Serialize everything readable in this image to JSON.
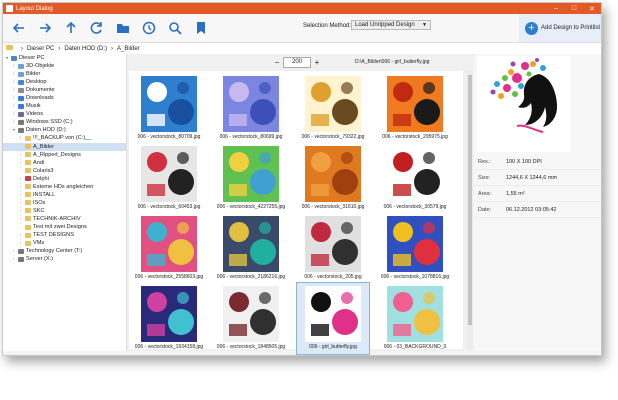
{
  "window": {
    "title": "Layout Dialog",
    "accent": "#e35a27"
  },
  "toolbar": {
    "icons": [
      "back-arrow-icon",
      "forward-arrow-icon",
      "up-arrow-icon",
      "refresh-icon",
      "folder-icon",
      "clock-icon",
      "zoom-icon",
      "bookmark-icon"
    ],
    "selection_label": "Selection Method:",
    "selection_value": "Load Unripped Design",
    "add_button": "Add Design to Printlist"
  },
  "breadcrumb": [
    "Dieser PC",
    "Daten HOD (D:)",
    "A_Bilder"
  ],
  "tree": [
    {
      "label": "Dieser PC",
      "indent": 0,
      "exp": "v",
      "color": "#4a86c8"
    },
    {
      "label": "3D-Objekte",
      "indent": 1,
      "exp": ">",
      "color": "#6aa0d8"
    },
    {
      "label": "Bilder",
      "indent": 1,
      "exp": ">",
      "color": "#6aa0d8"
    },
    {
      "label": "Desktop",
      "indent": 1,
      "exp": ">",
      "color": "#4a86c8"
    },
    {
      "label": "Dokumente",
      "indent": 1,
      "exp": ">",
      "color": "#8a8a8a"
    },
    {
      "label": "Downloads",
      "indent": 1,
      "exp": ">",
      "color": "#3a7bd5"
    },
    {
      "label": "Musik",
      "indent": 1,
      "exp": ">",
      "color": "#3a7bd5"
    },
    {
      "label": "Videos",
      "indent": 1,
      "exp": ">",
      "color": "#6a6a9a"
    },
    {
      "label": "Windows SSD (C:)",
      "indent": 1,
      "exp": ">",
      "color": "#777"
    },
    {
      "label": "Daten HOD (D:)",
      "indent": 1,
      "exp": "v",
      "color": "#777"
    },
    {
      "label": "!!!_BACKUP von (C:)__",
      "indent": 2,
      "exp": ">",
      "color": "#e8c25c"
    },
    {
      "label": "A_Bilder",
      "indent": 2,
      "exp": "",
      "color": "#e8c25c",
      "selected": true
    },
    {
      "label": "A_Ripped_Designs",
      "indent": 2,
      "exp": ">",
      "color": "#e8c25c"
    },
    {
      "label": "Andi",
      "indent": 2,
      "exp": ">",
      "color": "#e8c25c"
    },
    {
      "label": "Colaris3",
      "indent": 2,
      "exp": "",
      "color": "#e8c25c"
    },
    {
      "label": "Delphi",
      "indent": 2,
      "exp": ">",
      "color": "#d04040"
    },
    {
      "label": "Externe HDs angleichen",
      "indent": 2,
      "exp": ">",
      "color": "#e8c25c"
    },
    {
      "label": "INSTALL",
      "indent": 2,
      "exp": ">",
      "color": "#e8c25c"
    },
    {
      "label": "ISOs",
      "indent": 2,
      "exp": ">",
      "color": "#e8c25c"
    },
    {
      "label": "SKC",
      "indent": 2,
      "exp": ">",
      "color": "#e8c25c"
    },
    {
      "label": "TECHNIK-ARCHIV",
      "indent": 2,
      "exp": ">",
      "color": "#e8c25c"
    },
    {
      "label": "Test mit zwei Designs",
      "indent": 2,
      "exp": "",
      "color": "#e8c25c"
    },
    {
      "label": "TEST DESIGNS",
      "indent": 2,
      "exp": ">",
      "color": "#e8c25c"
    },
    {
      "label": "VMs",
      "indent": 2,
      "exp": ">",
      "color": "#e8c25c"
    },
    {
      "label": "Technology Center (T:)",
      "indent": 1,
      "exp": ">",
      "color": "#777"
    },
    {
      "label": "Server (X:)",
      "indent": 1,
      "exp": ">",
      "color": "#777"
    }
  ],
  "zoom": {
    "minus": "−",
    "value": "200",
    "plus": "+"
  },
  "current_path": "D:\\A_Bilder\\006 - girl_butterfly.jpg",
  "thumbnails": [
    {
      "caption": "006 - vectorstock_80709.jpg",
      "c1": "#2f7fd0",
      "c2": "#ffffff",
      "c3": "#1a4fa0"
    },
    {
      "caption": "006 - vectorstock_80699.jpg",
      "c1": "#7a86e0",
      "c2": "#c8b8f0",
      "c3": "#3f4fb8"
    },
    {
      "caption": "006 - vectorstock_79322.jpg",
      "c1": "#fff3d0",
      "c2": "#e0a030",
      "c3": "#6a4a20"
    },
    {
      "caption": "006 - vectorstock_295975.jpg",
      "c1": "#f07a20",
      "c2": "#c02a10",
      "c3": "#1a1a1a"
    },
    {
      "caption": "006 - vectorstock_60453.jpg",
      "c1": "#e6e6e6",
      "c2": "#d03040",
      "c3": "#222222"
    },
    {
      "caption": "006 - vectorstock_4227255.jpg",
      "c1": "#60c050",
      "c2": "#f0d040",
      "c3": "#40a0d0"
    },
    {
      "caption": "006 - vectorstock_31610.jpg",
      "c1": "#e07a20",
      "c2": "#f0a040",
      "c3": "#a04010"
    },
    {
      "caption": "006 - vectorstock_30579.jpg",
      "c1": "#ffffff",
      "c2": "#c02020",
      "c3": "#222222"
    },
    {
      "caption": "006 - vectorstock_2558603.jpg",
      "c1": "#e05080",
      "c2": "#40b0d0",
      "c3": "#f0c040"
    },
    {
      "caption": "006 - vectorstock_2186216.jpg",
      "c1": "#3a4a6a",
      "c2": "#e0c040",
      "c3": "#20b0a0"
    },
    {
      "caption": "006 - vectorstock_205.jpg",
      "c1": "#e0e0e0",
      "c2": "#c02a40",
      "c3": "#303030"
    },
    {
      "caption": "006 - vectorstock_1078816.jpg",
      "c1": "#3050c0",
      "c2": "#f0c020",
      "c3": "#e03040"
    },
    {
      "caption": "006 - vectorstock_1934158.jpg",
      "c1": "#2a2a7a",
      "c2": "#d040a0",
      "c3": "#40c0d0"
    },
    {
      "caption": "006 - vectorstock_1848505.jpg",
      "c1": "#f0f0f0",
      "c2": "#7a2a30",
      "c3": "#303030"
    },
    {
      "caption": "006 - girl_butterfly.jpg",
      "c1": "#ffffff",
      "c2": "#111111",
      "c3": "#e0308a",
      "selected": true
    },
    {
      "caption": "006 - 03_BACKGROUND_0",
      "c1": "#a0e0e0",
      "c2": "#f06090",
      "c3": "#f0c040"
    }
  ],
  "details": {
    "res_label": "Res.:",
    "res_value": "100 X 100 DPI",
    "size_label": "Size:",
    "size_value": "1244,6 X 1244,6 mm",
    "area_label": "Area:",
    "area_value": "1,55 m²",
    "date_label": "Date:",
    "date_value": "06.12.2012 03:05:42"
  }
}
